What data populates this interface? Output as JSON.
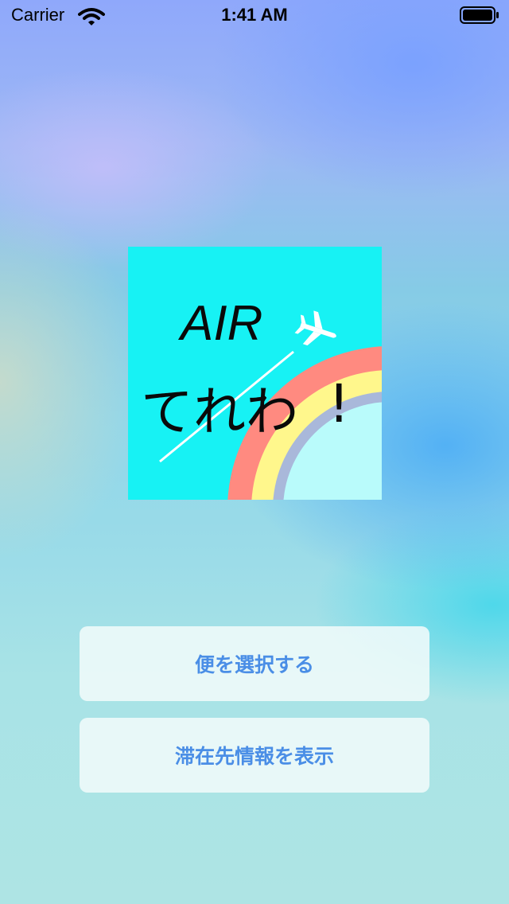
{
  "status_bar": {
    "carrier": "Carrier",
    "time": "1:41 AM"
  },
  "logo": {
    "text_top": "AIR",
    "text_bottom": "てれわ",
    "exclamation": "!",
    "background_color": "#17f2f4",
    "rainbow_colors": [
      "#ff8a80",
      "#fff78c",
      "#a9b8da"
    ],
    "plane_icon": "airplane-icon"
  },
  "actions": {
    "select_flight_label": "便を選択する",
    "show_stay_info_label": "滞在先情報を表示"
  },
  "colors": {
    "button_text": "#4a8ee6",
    "button_background": "#eef9f9"
  }
}
